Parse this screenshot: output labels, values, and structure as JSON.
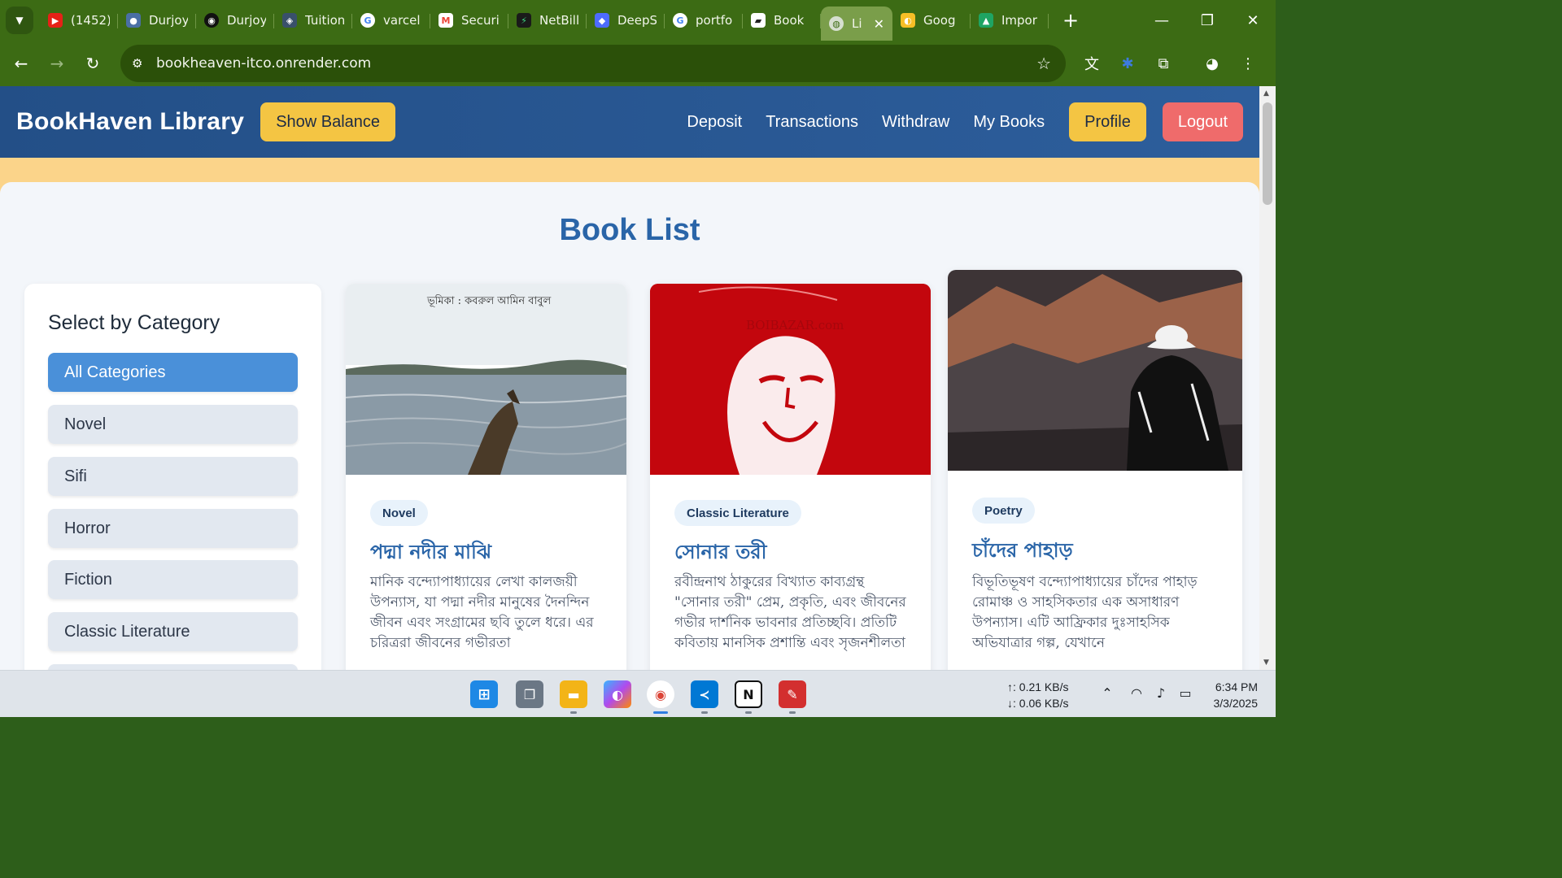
{
  "browser": {
    "tabs": [
      {
        "title": "(1452)",
        "icon": "youtube-icon",
        "color": "#e62117"
      },
      {
        "title": "Durjoy",
        "icon": "avatar-icon",
        "color": "#4a6fa5"
      },
      {
        "title": "Durjoy",
        "icon": "github-icon",
        "color": "#111111"
      },
      {
        "title": "Tuition",
        "icon": "tuition-icon",
        "color": "#39506b"
      },
      {
        "title": "varcel",
        "icon": "google-icon",
        "color": "#ffffff"
      },
      {
        "title": "Securi",
        "icon": "gmail-icon",
        "color": "#ea4335"
      },
      {
        "title": "NetBill",
        "icon": "netbill-icon",
        "color": "#1a1a1a"
      },
      {
        "title": "DeepS",
        "icon": "deepseek-icon",
        "color": "#4d6bfe"
      },
      {
        "title": "portfo",
        "icon": "google-icon",
        "color": "#ffffff"
      },
      {
        "title": "Book",
        "icon": "book-icon",
        "color": "#222222"
      },
      {
        "title": "Li",
        "icon": "globe-icon",
        "color": "#d6dfd0",
        "active": true
      },
      {
        "title": "Goog",
        "icon": "keep-icon",
        "color": "#f6bf26"
      },
      {
        "title": "Impor",
        "icon": "drive-icon",
        "color": "#1fa463"
      }
    ],
    "url": "bookheaven-itco.onrender.com"
  },
  "navbar": {
    "brand": "BookHaven Library",
    "show_balance": "Show Balance",
    "links": [
      "Deposit",
      "Transactions",
      "Withdraw",
      "My Books"
    ],
    "profile": "Profile",
    "logout": "Logout"
  },
  "main": {
    "title": "Book List"
  },
  "sidebar": {
    "heading": "Select by Category",
    "categories": [
      "All Categories",
      "Novel",
      "Sifi",
      "Horror",
      "Fiction",
      "Classic Literature"
    ]
  },
  "books": [
    {
      "category": "Novel",
      "title": "পদ্মা নদীর মাঝি",
      "description": "মানিক বন্দ্যোপাধ্যায়ের লেখা কালজয়ী উপন্যাস, যা পদ্মা নদীর মানুষের দৈনন্দিন জীবন এবং সংগ্রামের ছবি তুলে ধরে। এর চরিত্ররা জীবনের গভীরতা",
      "cover_text": "ভূমিকা : কবরুল আমিন বাবুল"
    },
    {
      "category": "Classic Literature",
      "title": "সোনার তরী",
      "description": "রবীন্দ্রনাথ ঠাকুরের বিখ্যাত কাব্যগ্রন্থ \"সোনার তরী\" প্রেম, প্রকৃতি, এবং জীবনের গভীর দার্শনিক ভাবনার প্রতিচ্ছবি। প্রতিটি কবিতায় মানসিক প্রশান্তি এবং সৃজনশীলতা",
      "cover_text": "BOIBAZAR.com"
    },
    {
      "category": "Poetry",
      "title": "চাঁদের পাহাড়",
      "description": "বিভূতিভূষণ বন্দ্যোপাধ্যায়ের চাঁদের পাহাড় রোমাঞ্চ ও সাহসিকতার এক অসাধারণ উপন্যাস। এটি আফ্রিকার দুঃসাহসিক অভিযাত্রার গল্প, যেখানে",
      "cover_text": ""
    }
  ],
  "taskbar": {
    "upload": "↑: 0.21 KB/s",
    "download": "↓: 0.06 KB/s",
    "time": "6:34 PM",
    "date": "3/3/2025"
  },
  "colors": {
    "navbar": "#2d5e9c",
    "accent_yellow": "#f4c543",
    "logout_red": "#ef6b6b",
    "category_active": "#4a90d9",
    "title_blue": "#2a65a8"
  }
}
